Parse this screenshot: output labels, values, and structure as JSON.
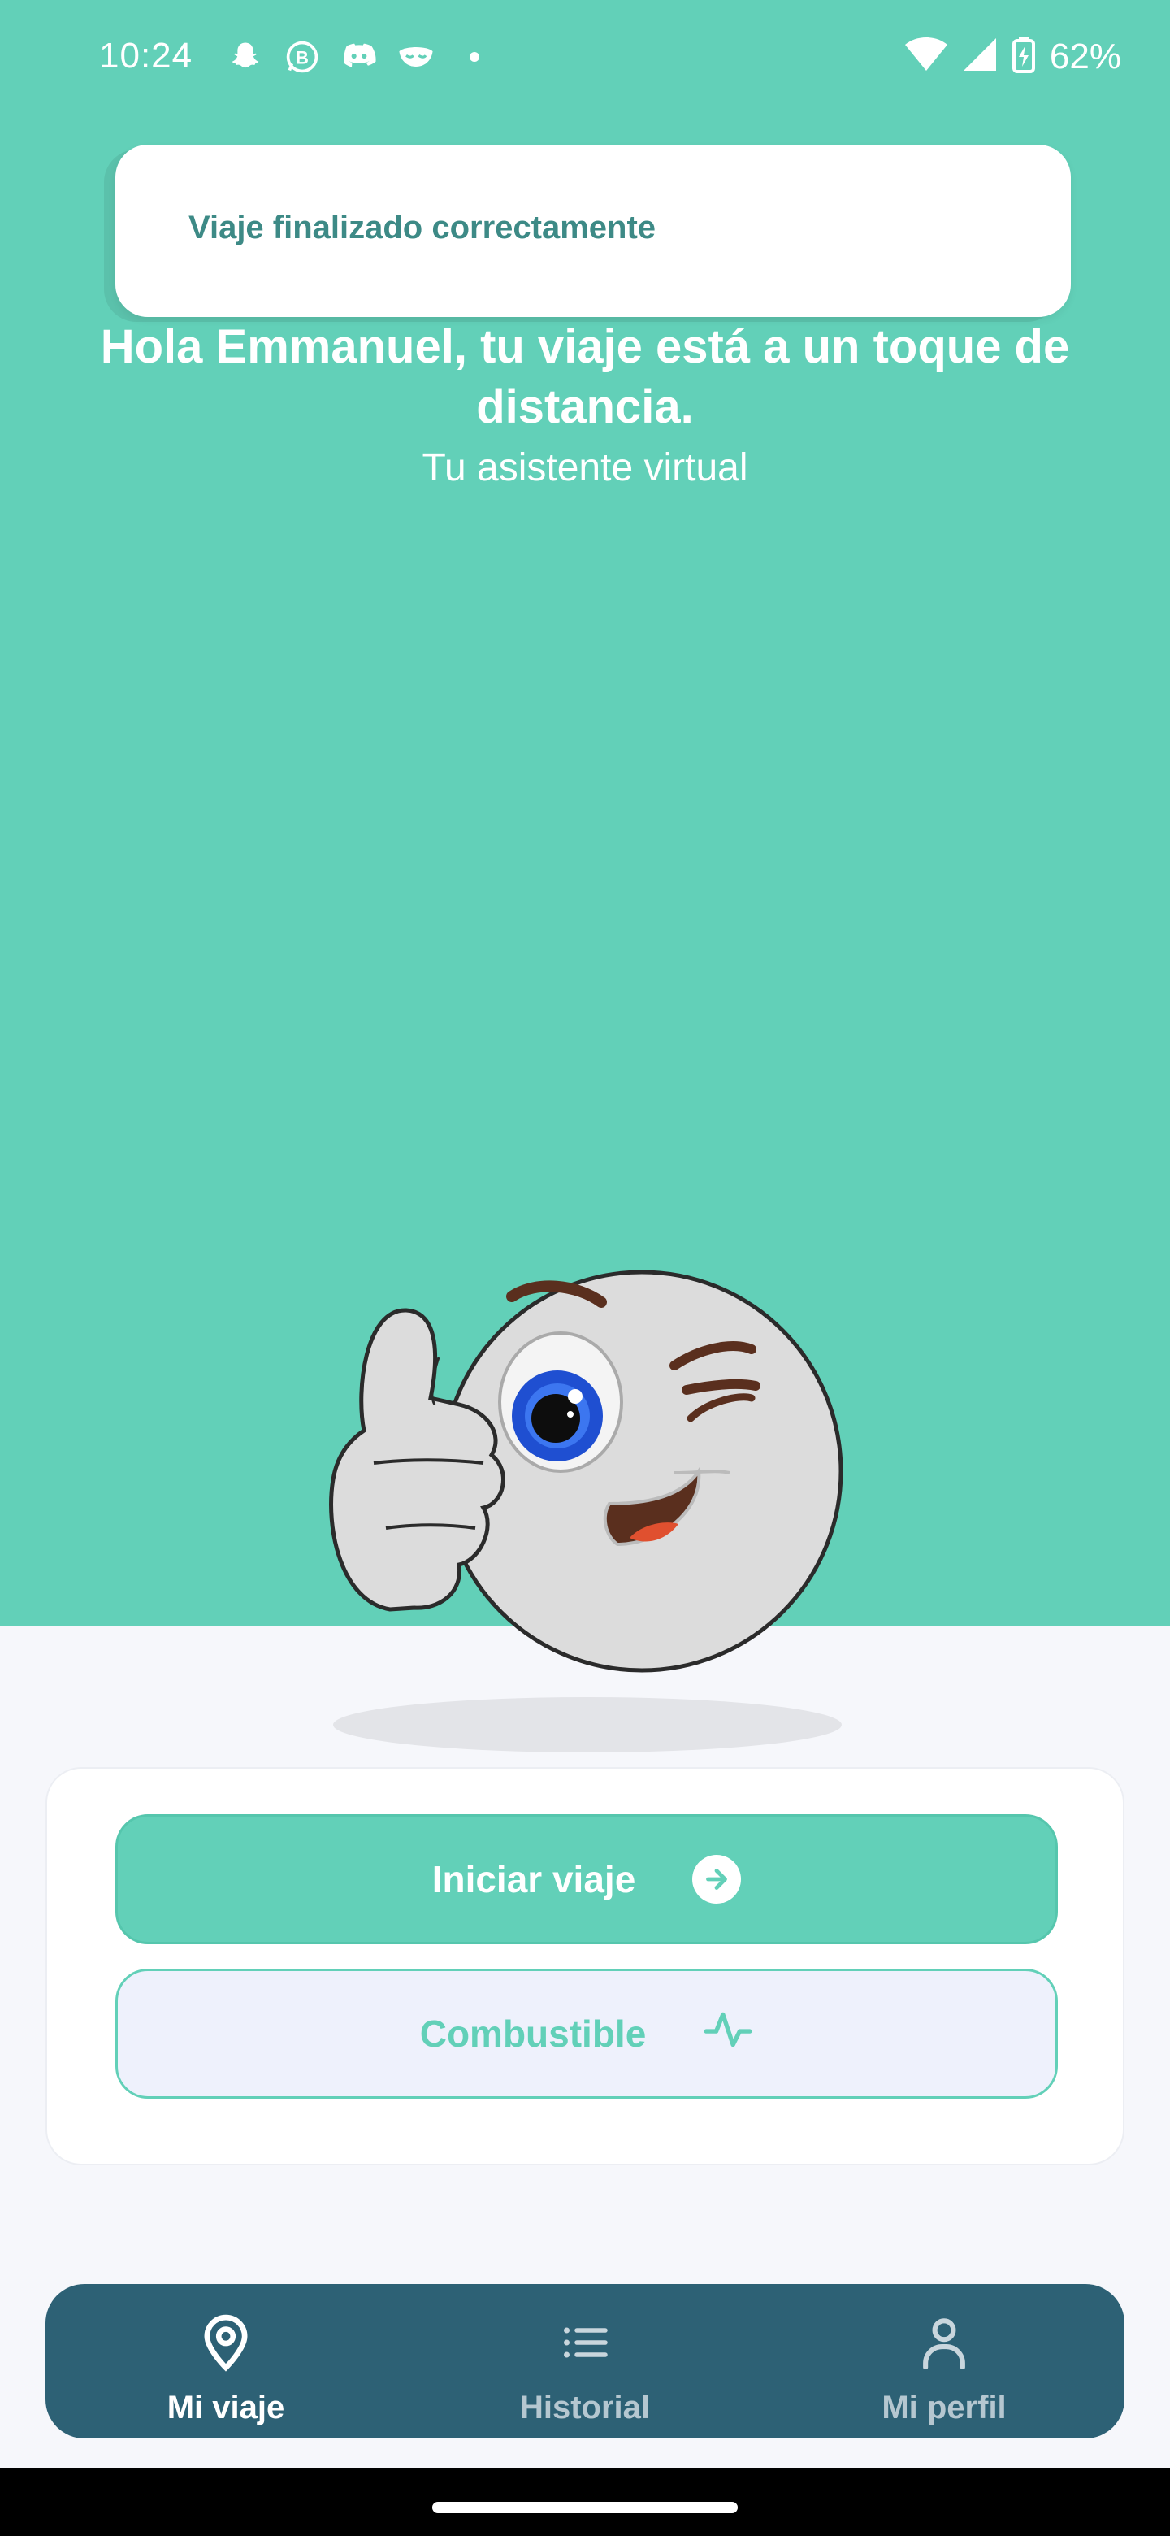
{
  "status_bar": {
    "time": "10:24",
    "left_icons": [
      "snapchat-icon",
      "whatsapp-business-icon",
      "discord-icon",
      "mask-app-icon"
    ],
    "battery_text": "62%"
  },
  "toast": {
    "message": "Viaje finalizado correctamente"
  },
  "greeting": {
    "title": "Hola Emmanuel, tu viaje está a un toque de distancia.",
    "subtitle": "Tu asistente virtual"
  },
  "actions": {
    "start_label": "Iniciar viaje",
    "fuel_label": "Combustible"
  },
  "nav": {
    "items": [
      {
        "label": "Mi viaje",
        "icon": "location-pin-icon",
        "active": true
      },
      {
        "label": "Historial",
        "icon": "list-icon",
        "active": false
      },
      {
        "label": "Mi perfil",
        "icon": "user-icon",
        "active": false
      }
    ]
  },
  "colors": {
    "primary": "#62d0b8",
    "nav_background": "#2d6175",
    "toast_text": "#3d8a86",
    "fuel_button_bg": "#eef1fc"
  }
}
